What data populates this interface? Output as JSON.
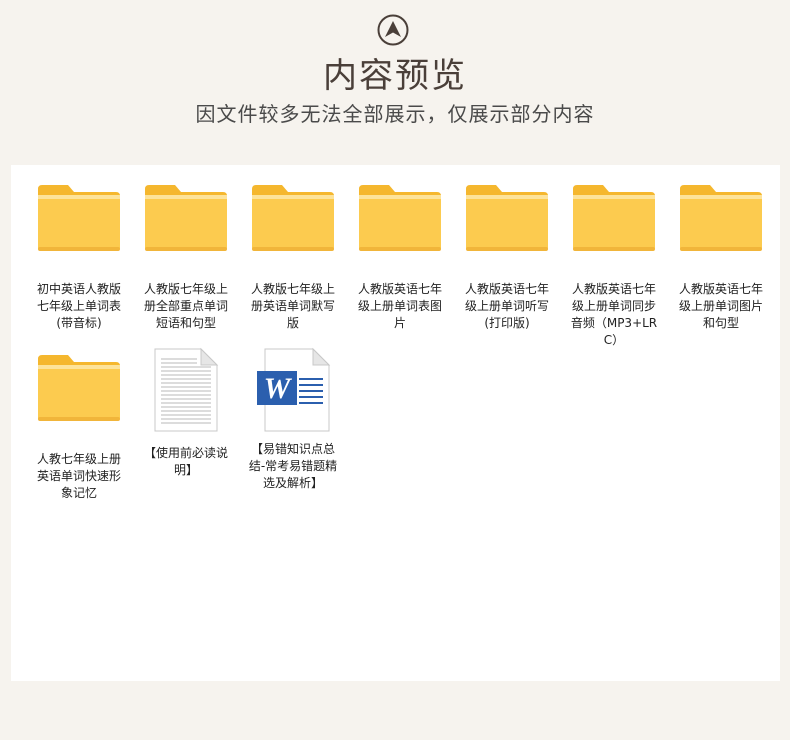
{
  "header": {
    "title": "内容预览",
    "subtitle": "因文件较多无法全部展示，仅展示部分内容"
  },
  "files": [
    {
      "label": "初中英语人教版七年级上单词表(带音标)",
      "type": "folder"
    },
    {
      "label": "人教版七年级上册全部重点单词短语和句型",
      "type": "folder"
    },
    {
      "label": "人教版七年级上册英语单词默写版",
      "type": "folder"
    },
    {
      "label": "人教版英语七年级上册单词表图片",
      "type": "folder"
    },
    {
      "label": "人教版英语七年级上册单词听写(打印版)",
      "type": "folder"
    },
    {
      "label": "人教版英语七年级上册单词同步音频（MP3+LRC）",
      "type": "folder"
    },
    {
      "label": "人教版英语七年级上册单词图片和句型",
      "type": "folder"
    },
    {
      "label": "人教七年级上册英语单词快速形象记忆",
      "type": "folder"
    },
    {
      "label": "【使用前必读说明】",
      "type": "text-document"
    },
    {
      "label": "【易错知识点总结-常考易错题精选及解析】",
      "type": "word-document"
    }
  ],
  "colors": {
    "background": "#f6f3ee",
    "panel": "#ffffff",
    "folder": "#fccb4f",
    "word_blue": "#2b5fae"
  }
}
